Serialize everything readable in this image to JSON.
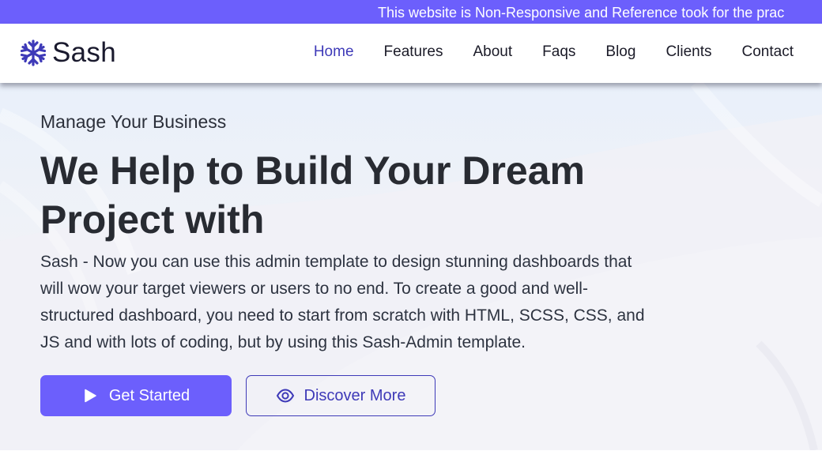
{
  "announcement": {
    "text": "This website is Non-Responsive and Reference took for the prac"
  },
  "brand": {
    "name": "Sash",
    "icon": "snowflake-icon",
    "color": "#3e3ab8"
  },
  "nav": {
    "items": [
      {
        "label": "Home",
        "active": true
      },
      {
        "label": "Features",
        "active": false
      },
      {
        "label": "About",
        "active": false
      },
      {
        "label": "Faqs",
        "active": false
      },
      {
        "label": "Blog",
        "active": false
      },
      {
        "label": "Clients",
        "active": false
      },
      {
        "label": "Contact",
        "active": false
      }
    ]
  },
  "hero": {
    "eyebrow": "Manage Your Business",
    "headline": "We Help to Build Your Dream Project with",
    "description": "Sash - Now you can use this admin template to design stunning dashboards that will wow your target viewers or users to no end. To create a good and well-structured dashboard, you need to start from scratch with HTML, SCSS, CSS, and JS and with lots of coding, but by using this Sash-Admin template.",
    "primary_button": {
      "label": "Get Started",
      "icon": "play-icon"
    },
    "secondary_button": {
      "label": "Discover More",
      "icon": "eye-icon"
    }
  },
  "colors": {
    "primary": "#6c5ffc",
    "accent_text": "#3e3ab8",
    "hero_background": "#eef1f7"
  }
}
